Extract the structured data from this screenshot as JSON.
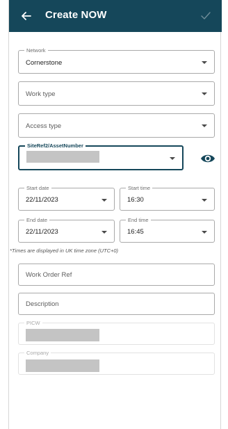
{
  "header": {
    "title": "Create NOW",
    "back_icon": "arrow-left-icon",
    "confirm_icon": "check-icon",
    "bg_color": "#15475a"
  },
  "form": {
    "network": {
      "label": "Network",
      "value": "Cornerstone"
    },
    "work_type": {
      "placeholder": "Work type"
    },
    "access_type": {
      "placeholder": "Access type"
    },
    "site_ref": {
      "label": "SiteRef2/AssetNumber",
      "value_redacted": true
    },
    "visibility_icon": "eye-icon",
    "start_date": {
      "label": "Start date",
      "value": "22/11/2023"
    },
    "start_time": {
      "label": "Start time",
      "value": "16:30"
    },
    "end_date": {
      "label": "End date",
      "value": "22/11/2023"
    },
    "end_time": {
      "label": "End time",
      "value": "16:45"
    },
    "timezone_note": "*Times are displayed in UK time zone (UTC+0)",
    "work_order_ref": {
      "placeholder": "Work Order Ref"
    },
    "description": {
      "placeholder": "Description"
    },
    "picw": {
      "label": "PICW",
      "value_redacted": true
    },
    "company": {
      "label": "Company",
      "value_redacted": true
    }
  }
}
